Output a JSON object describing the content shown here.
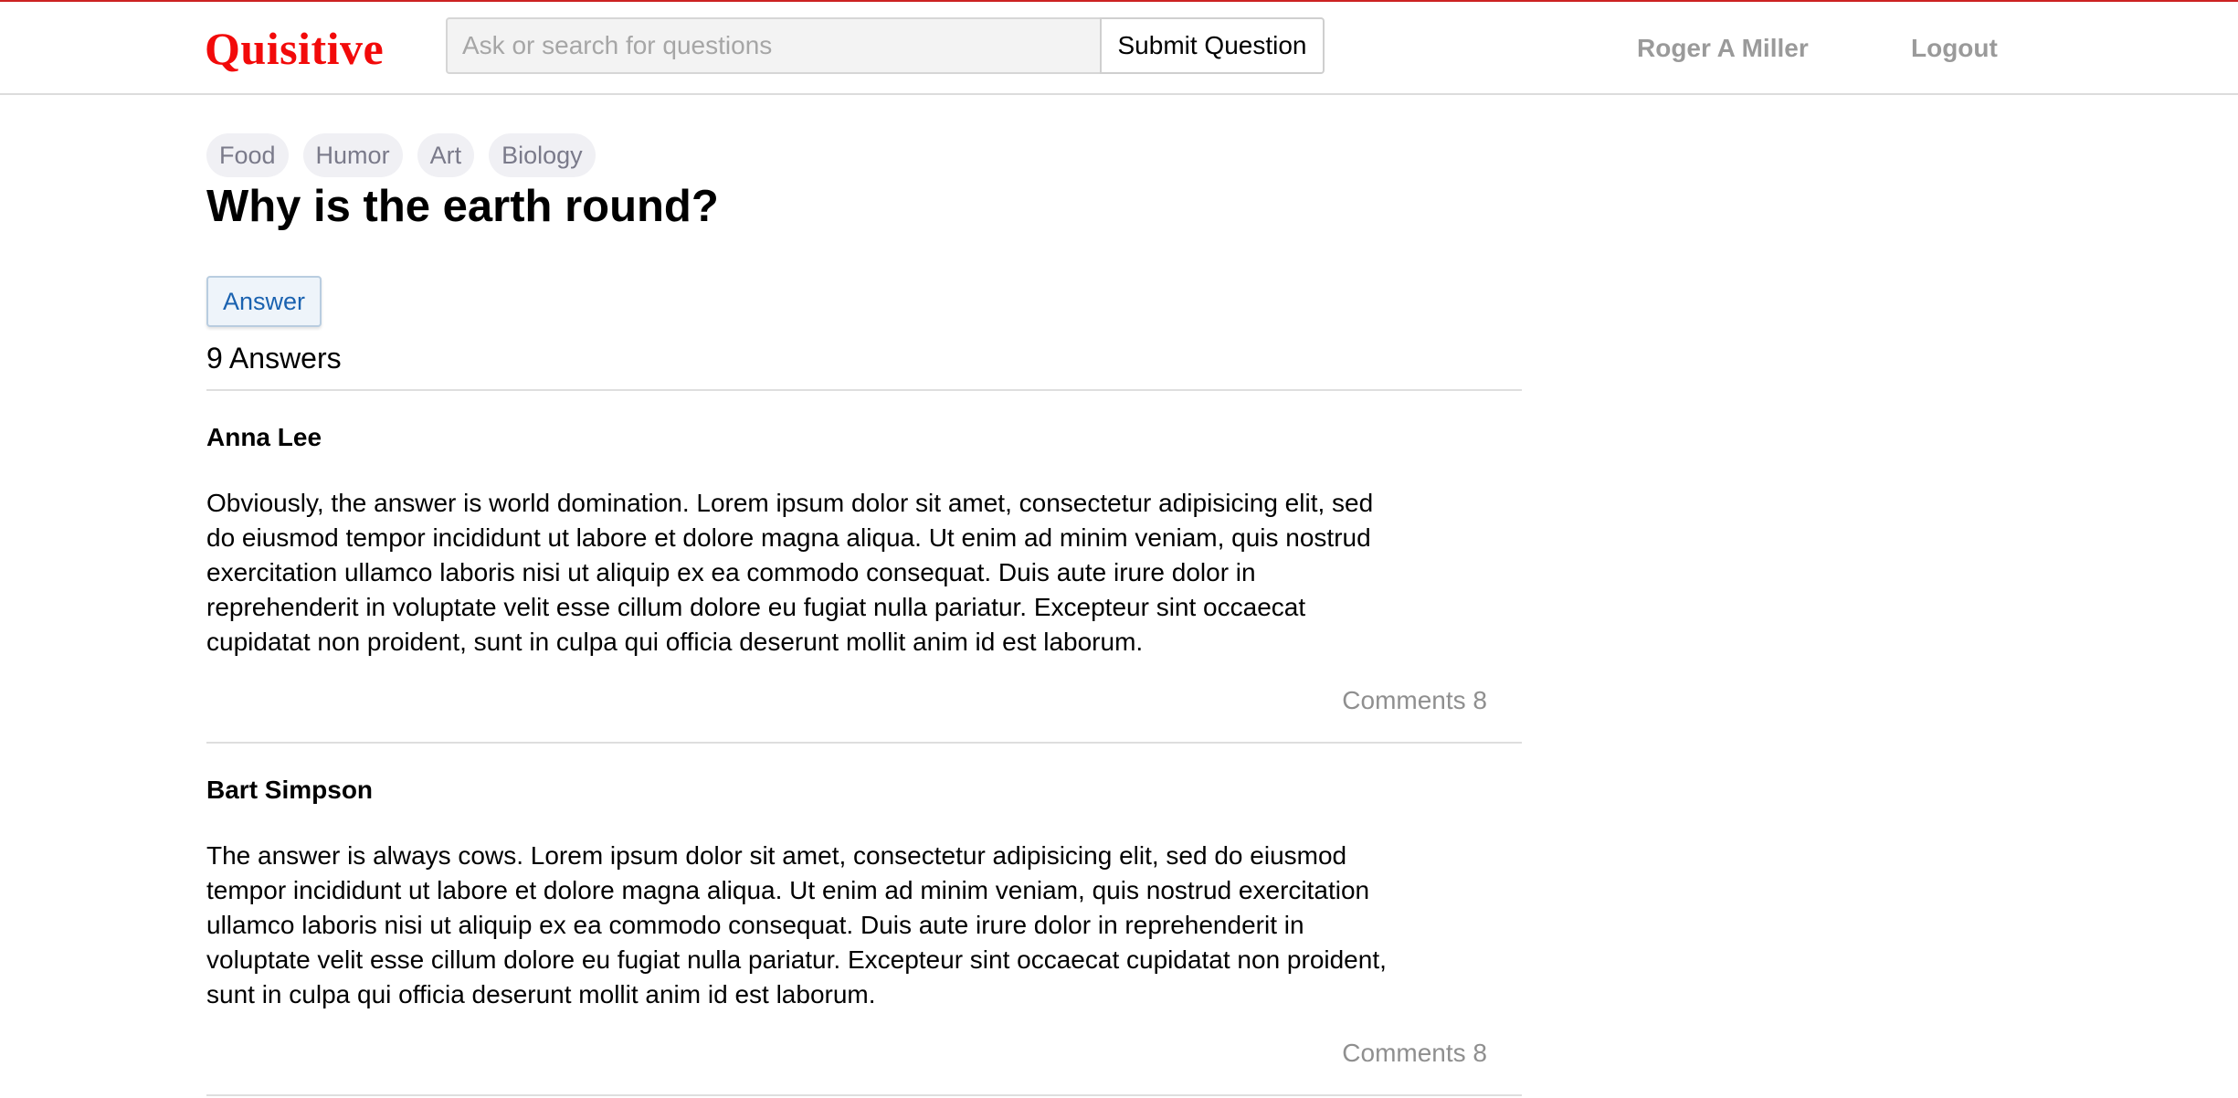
{
  "brand": {
    "name": "Quisitive"
  },
  "search": {
    "placeholder": "Ask or search for questions"
  },
  "header": {
    "submit_label": "Submit Question",
    "user_name": "Roger A Miller",
    "logout_label": "Logout"
  },
  "question": {
    "tags": [
      "Food",
      "Humor",
      "Art",
      "Biology"
    ],
    "title": "Why is the earth round?",
    "answer_button": "Answer",
    "answers_count": "9 Answers"
  },
  "answers": [
    {
      "author": "Anna Lee",
      "body": "Obviously, the answer is world domination. Lorem ipsum dolor sit amet, consectetur adipisicing elit, sed do eiusmod tempor incididunt ut labore et dolore magna aliqua. Ut enim ad minim veniam, quis nostrud exercitation ullamco laboris nisi ut aliquip ex ea commodo consequat. Duis aute irure dolor in reprehenderit in voluptate velit esse cillum dolore eu fugiat nulla pariatur. Excepteur sint occaecat cupidatat non proident, sunt in culpa qui officia deserunt mollit anim id est laborum.",
      "comments": "Comments 8"
    },
    {
      "author": "Bart Simpson",
      "body": "The answer is always cows. Lorem ipsum dolor sit amet, consectetur adipisicing elit, sed do eiusmod tempor incididunt ut labore et dolore magna aliqua. Ut enim ad minim veniam, quis nostrud exercitation ullamco laboris nisi ut aliquip ex ea commodo consequat. Duis aute irure dolor in reprehenderit in voluptate velit esse cillum dolore eu fugiat nulla pariatur. Excepteur sint occaecat cupidatat non proident, sunt in culpa qui officia deserunt mollit anim id est laborum.",
      "comments": "Comments 8"
    }
  ],
  "colors": {
    "brand": "#f20a0a",
    "top_accent": "#cc2222",
    "link_blue": "#1a62b0",
    "muted_text": "#9a9a9a"
  }
}
